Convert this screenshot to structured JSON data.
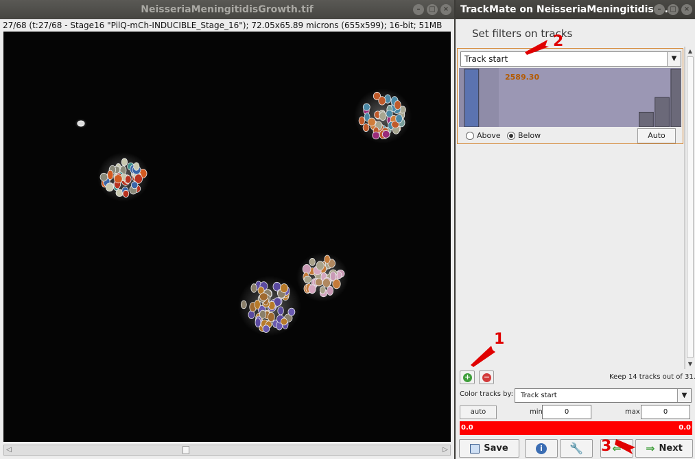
{
  "image_window": {
    "title": "NeisseriaMeningitidisGrowth.tif",
    "info": "27/68 (t:27/68 - Stage16 \"PilQ-mCh-INDUCIBLE_Stage_16\"); 72.05x65.89 microns (655x599); 16-bit; 51MB"
  },
  "trackmate": {
    "title": "TrackMate on NeisseriaMeningitidisG…",
    "heading": "Set filters on tracks",
    "filter": {
      "feature": "Track start",
      "threshold_value": "2589.30",
      "above_label": "Above",
      "below_label": "Below",
      "selected": "Below",
      "auto_label": "Auto",
      "histogram_levels": [
        0.98,
        0,
        0,
        0,
        0,
        0,
        0,
        0,
        0,
        0,
        0,
        0.25,
        0.5,
        0.98
      ]
    },
    "keep_text": "Keep 14 tracks out of  31.",
    "color_by_label": "Color tracks by:",
    "color_by_value": "Track start",
    "minmax_auto_label": "auto",
    "min_label": "min",
    "min_value": "0",
    "max_label": "max",
    "max_value": "0",
    "colorbar_left": "0.0",
    "colorbar_right": "0.0",
    "save_label": "Save",
    "next_label": "Next"
  },
  "annotations": {
    "a1": "1",
    "a2": "2",
    "a3": "3"
  },
  "colors": {
    "accent": "#d58a3a",
    "colorbar": "#ff0000",
    "threshold_text": "#b35a00",
    "annotation": "#e00000"
  }
}
